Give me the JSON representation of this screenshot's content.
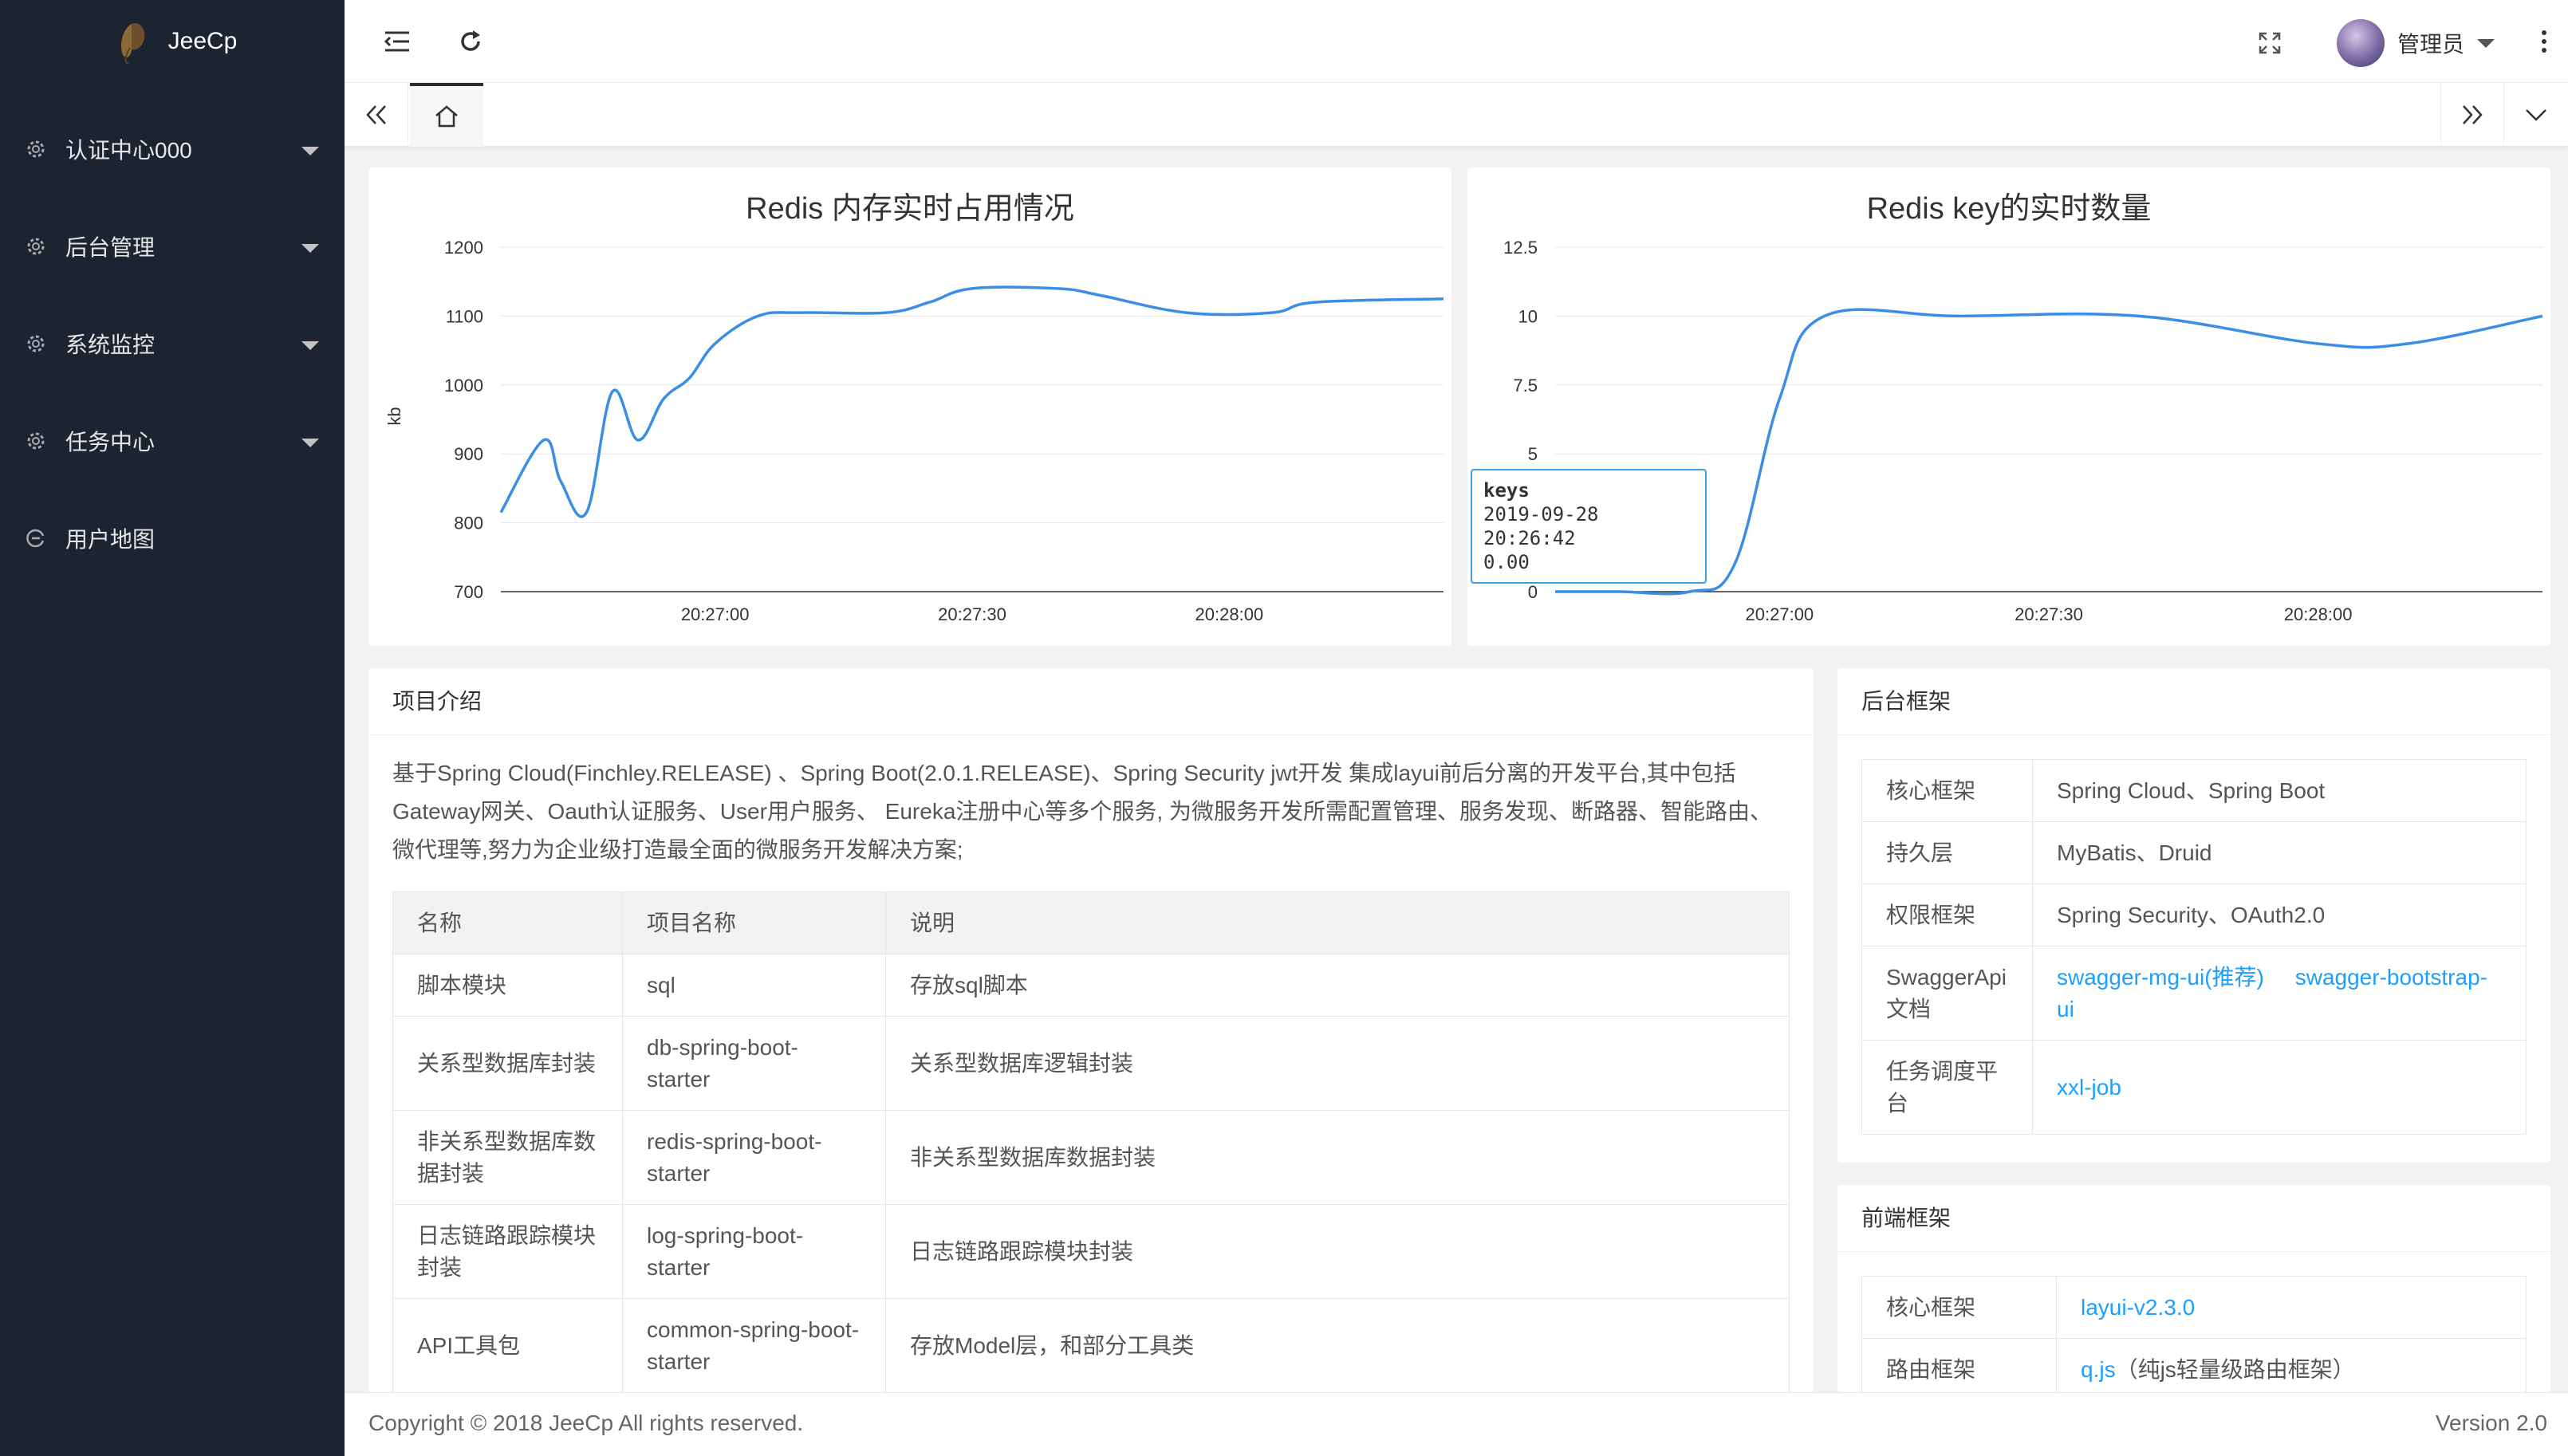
{
  "app": {
    "logo_text": "JeeCp"
  },
  "sidebar": {
    "items": [
      {
        "label": "认证中心000",
        "icon": "gear-icon"
      },
      {
        "label": "后台管理",
        "icon": "gear-icon"
      },
      {
        "label": "系统监控",
        "icon": "gear-icon"
      },
      {
        "label": "任务中心",
        "icon": "gear-icon"
      },
      {
        "label": "用户地图",
        "icon": "circle-icon"
      }
    ]
  },
  "header": {
    "user_name": "管理员"
  },
  "charts": {
    "memory": {
      "title": "Redis 内存实时占用情况",
      "ylabel": "kb",
      "yticks": [
        "1200",
        "1100",
        "1000",
        "900",
        "800",
        "700"
      ],
      "xticks": [
        "20:27:00",
        "20:27:30",
        "20:28:00"
      ]
    },
    "keys": {
      "title": "Redis key的实时数量",
      "yticks": [
        "12.5",
        "10",
        "7.5",
        "5",
        "0"
      ],
      "xticks": [
        "20:27:00",
        "20:27:30",
        "20:28:00"
      ],
      "tooltip": {
        "series": "keys",
        "time": "2019-09-28 20:26:42",
        "value": "0.00"
      }
    }
  },
  "chart_data": [
    {
      "type": "line",
      "title": "Redis 内存实时占用情况",
      "ylabel": "kb",
      "xlabel": "",
      "ylim": [
        700,
        1200
      ],
      "xlim": [
        "20:26:35",
        "20:28:25"
      ],
      "x": [
        "20:26:35",
        "20:26:40",
        "20:26:42",
        "20:26:45",
        "20:26:48",
        "20:26:51",
        "20:26:54",
        "20:26:57",
        "20:27:00",
        "20:27:05",
        "20:27:10",
        "20:27:20",
        "20:27:25",
        "20:27:30",
        "20:27:40",
        "20:27:45",
        "20:27:55",
        "20:28:05",
        "20:28:10",
        "20:28:25"
      ],
      "series": [
        {
          "values": [
            815,
            920,
            860,
            815,
            990,
            920,
            980,
            1010,
            1060,
            1100,
            1105,
            1105,
            1120,
            1140,
            1140,
            1130,
            1105,
            1105,
            1120,
            1125
          ]
        }
      ]
    },
    {
      "type": "line",
      "title": "Redis key的实时数量",
      "xlabel": "",
      "ylabel": "",
      "ylim": [
        0,
        12.5
      ],
      "xlim": [
        "20:26:35",
        "20:28:25"
      ],
      "x": [
        "20:26:35",
        "20:26:42",
        "20:26:50",
        "20:26:55",
        "20:27:00",
        "20:27:05",
        "20:27:20",
        "20:27:40",
        "20:28:00",
        "20:28:10",
        "20:28:25"
      ],
      "series": [
        {
          "name": "keys",
          "values": [
            0,
            0,
            0,
            1,
            7,
            10,
            10,
            10,
            9,
            9,
            10
          ]
        }
      ]
    }
  ],
  "intro": {
    "title": "项目介绍",
    "text": "基于Spring Cloud(Finchley.RELEASE) 、Spring Boot(2.0.1.RELEASE)、Spring Security jwt开发 集成layui前后分离的开发平台,其中包括Gateway网关、Oauth认证服务、User用户服务、 Eureka注册中心等多个服务, 为微服务开发所需配置管理、服务发现、断路器、智能路由、微代理等,努力为企业级打造最全面的微服务开发解决方案;",
    "headers": [
      "名称",
      "项目名称",
      "说明"
    ],
    "rows": [
      [
        "脚本模块",
        "sql",
        "存放sql脚本"
      ],
      [
        "关系型数据库封装",
        "db-spring-boot-starter",
        "关系型数据库逻辑封装"
      ],
      [
        "非关系型数据库数据封装",
        "redis-spring-boot-starter",
        "非关系型数据库数据封装"
      ],
      [
        "日志链路跟踪模块封装",
        "log-spring-boot-starter",
        "日志链路跟踪模块封装"
      ],
      [
        "API工具包",
        "common-spring-boot-starter",
        "存放Model层，和部分工具类"
      ]
    ]
  },
  "backend": {
    "title": "后台框架",
    "rows": [
      {
        "k": "核心框架",
        "v": "Spring Cloud、Spring Boot"
      },
      {
        "k": "持久层",
        "v": "MyBatis、Druid"
      },
      {
        "k": "权限框架",
        "v": "Spring Security、OAuth2.0"
      },
      {
        "k": "SwaggerApi文档",
        "link1": "swagger-mg-ui(推荐)",
        "link2": "swagger-bootstrap-ui"
      },
      {
        "k": "任务调度平台",
        "link1": "xxl-job"
      }
    ]
  },
  "frontend": {
    "title": "前端框架",
    "rows": [
      {
        "k": "核心框架",
        "link": "layui-v2.3.0"
      },
      {
        "k": "路由框架",
        "link": "q.js",
        "note": "（纯js轻量级路由框架）"
      }
    ]
  },
  "footer": {
    "copyright": "Copyright © 2018 JeeCp All rights reserved.",
    "version": "Version 2.0"
  },
  "colors": {
    "sidebar": "#1c2331",
    "line": "#3a8ee6",
    "link": "#1e9fff"
  }
}
